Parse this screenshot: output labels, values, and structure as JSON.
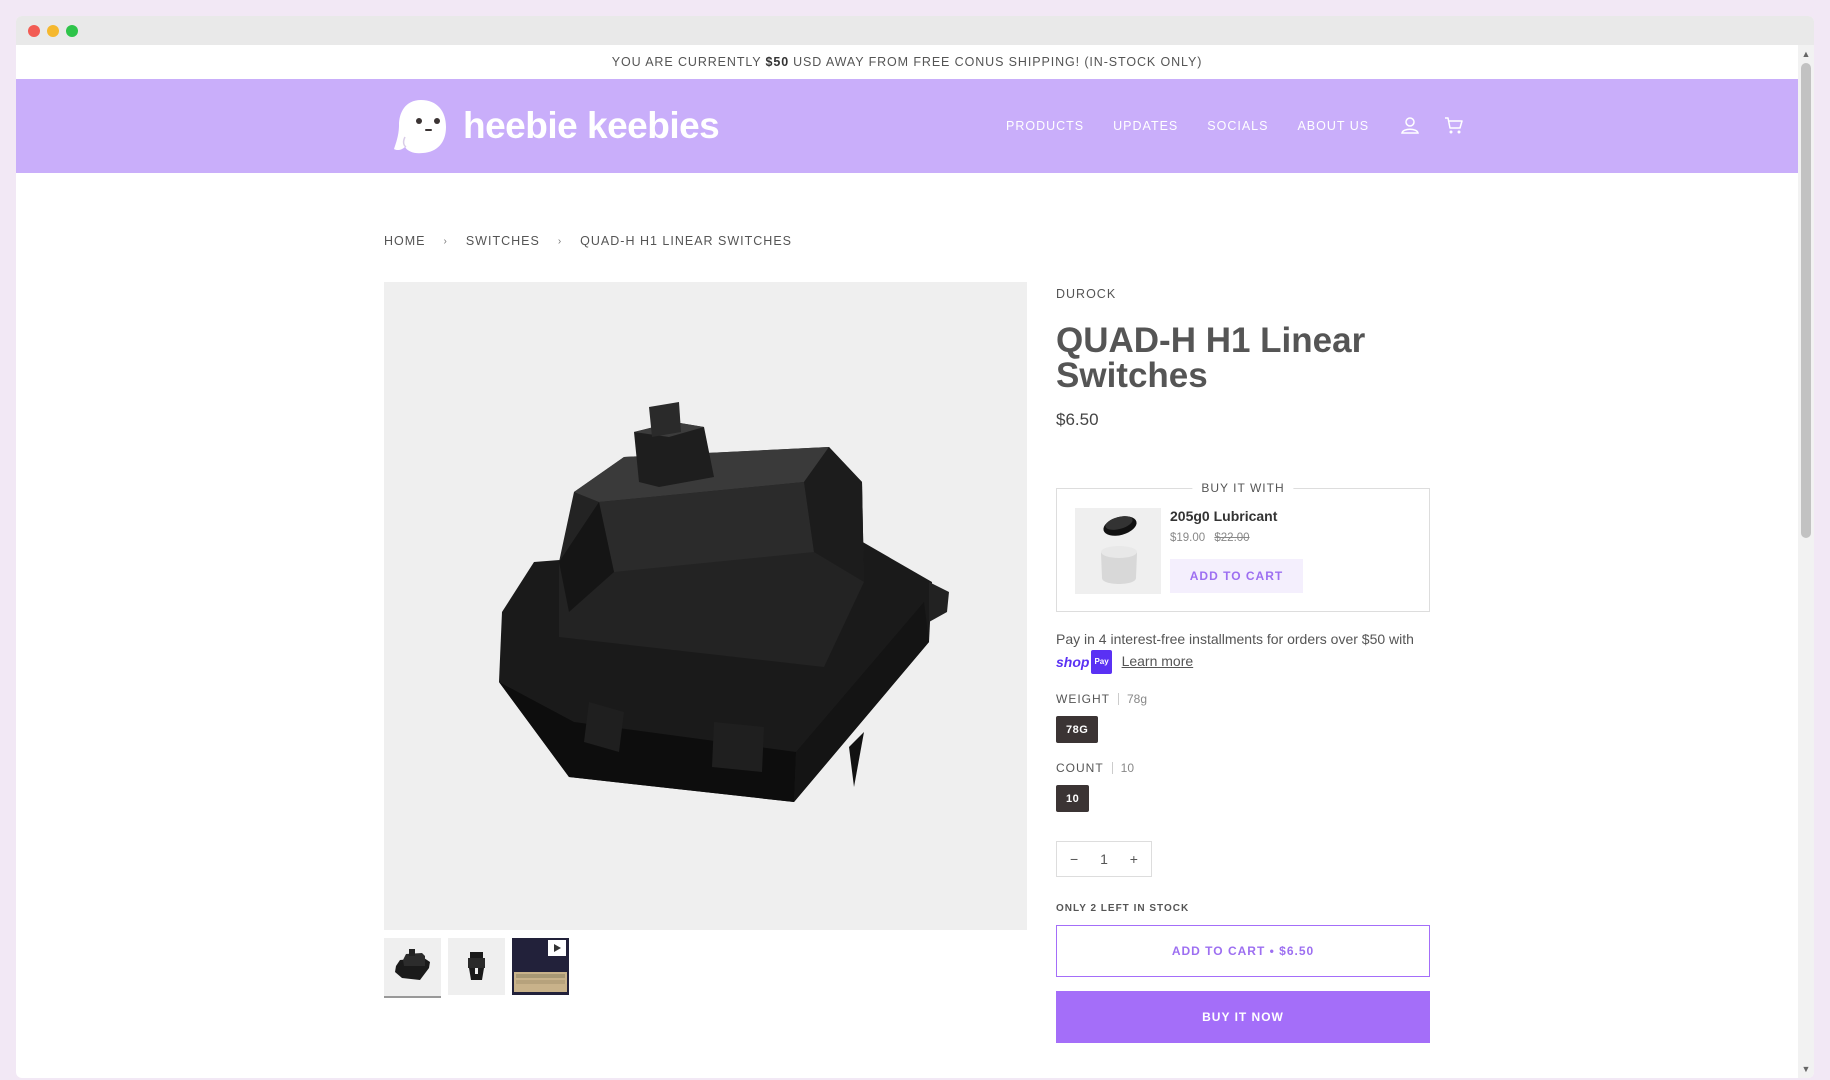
{
  "announcement": {
    "prefix": "YOU ARE CURRENTLY",
    "amount": "$50",
    "suffix": "USD AWAY FROM FREE CONUS SHIPPING! (IN-STOCK ONLY)"
  },
  "header": {
    "logo_text": "heebie keebies",
    "nav": [
      "PRODUCTS",
      "UPDATES",
      "SOCIALS",
      "ABOUT US"
    ],
    "icons": [
      "account-icon",
      "cart-icon"
    ],
    "background": "#c9aefa"
  },
  "breadcrumb": [
    "HOME",
    "SWITCHES",
    "QUAD-H H1 LINEAR SWITCHES"
  ],
  "product": {
    "vendor": "DUROCK",
    "title": "QUAD-H H1 Linear Switches",
    "price": "$6.50",
    "images": [
      "switch-black",
      "switch-side",
      "keyboard-video"
    ]
  },
  "bundle": {
    "legend": "BUY IT WITH",
    "name": "205g0 Lubricant",
    "price": "$19.00",
    "compare_price": "$22.00",
    "button": "ADD TO CART"
  },
  "installments": {
    "text": "Pay in 4 interest-free installments for orders over $50 with",
    "shop": "shop",
    "pay": "Pay",
    "learn_more": "Learn more"
  },
  "options": {
    "weight": {
      "label": "WEIGHT",
      "selected": "78g",
      "swatch": "78G"
    },
    "count": {
      "label": "COUNT",
      "selected": "10",
      "swatch": "10"
    }
  },
  "quantity": {
    "minus": "−",
    "value": "1",
    "plus": "+"
  },
  "stock_text": "ONLY 2 LEFT IN STOCK",
  "add_to_cart": "ADD TO CART • $6.50",
  "buy_now": "BUY IT NOW",
  "accent_color": "#a46ef9"
}
